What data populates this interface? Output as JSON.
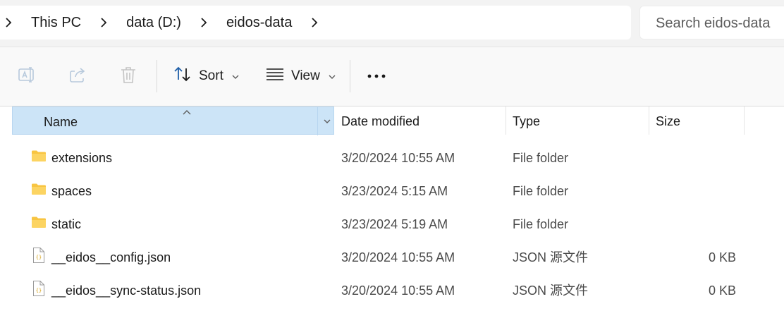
{
  "breadcrumb": {
    "items": [
      "This PC",
      "data (D:)",
      "eidos-data"
    ]
  },
  "search": {
    "placeholder": "Search eidos-data"
  },
  "toolbar": {
    "sort_label": "Sort",
    "view_label": "View",
    "icons": [
      "rename-icon",
      "share-icon",
      "delete-icon",
      "sort-icon",
      "view-icon",
      "more-icon"
    ]
  },
  "columns": {
    "name": "Name",
    "date": "Date modified",
    "type": "Type",
    "size": "Size"
  },
  "files": [
    {
      "name": "extensions",
      "date": "3/20/2024 10:55 AM",
      "type": "File folder",
      "size": "",
      "icon": "folder-icon"
    },
    {
      "name": "spaces",
      "date": "3/23/2024 5:15 AM",
      "type": "File folder",
      "size": "",
      "icon": "folder-icon"
    },
    {
      "name": "static",
      "date": "3/23/2024 5:19 AM",
      "type": "File folder",
      "size": "",
      "icon": "folder-icon"
    },
    {
      "name": "__eidos__config.json",
      "date": "3/20/2024 10:55 AM",
      "type": "JSON 源文件",
      "size": "0 KB",
      "icon": "json-file-icon"
    },
    {
      "name": "__eidos__sync-status.json",
      "date": "3/20/2024 10:55 AM",
      "type": "JSON 源文件",
      "size": "0 KB",
      "icon": "json-file-icon"
    }
  ],
  "colors": {
    "header_selected": "#cce4f7",
    "folder": "#f8c542",
    "accent": "#005fb8"
  }
}
